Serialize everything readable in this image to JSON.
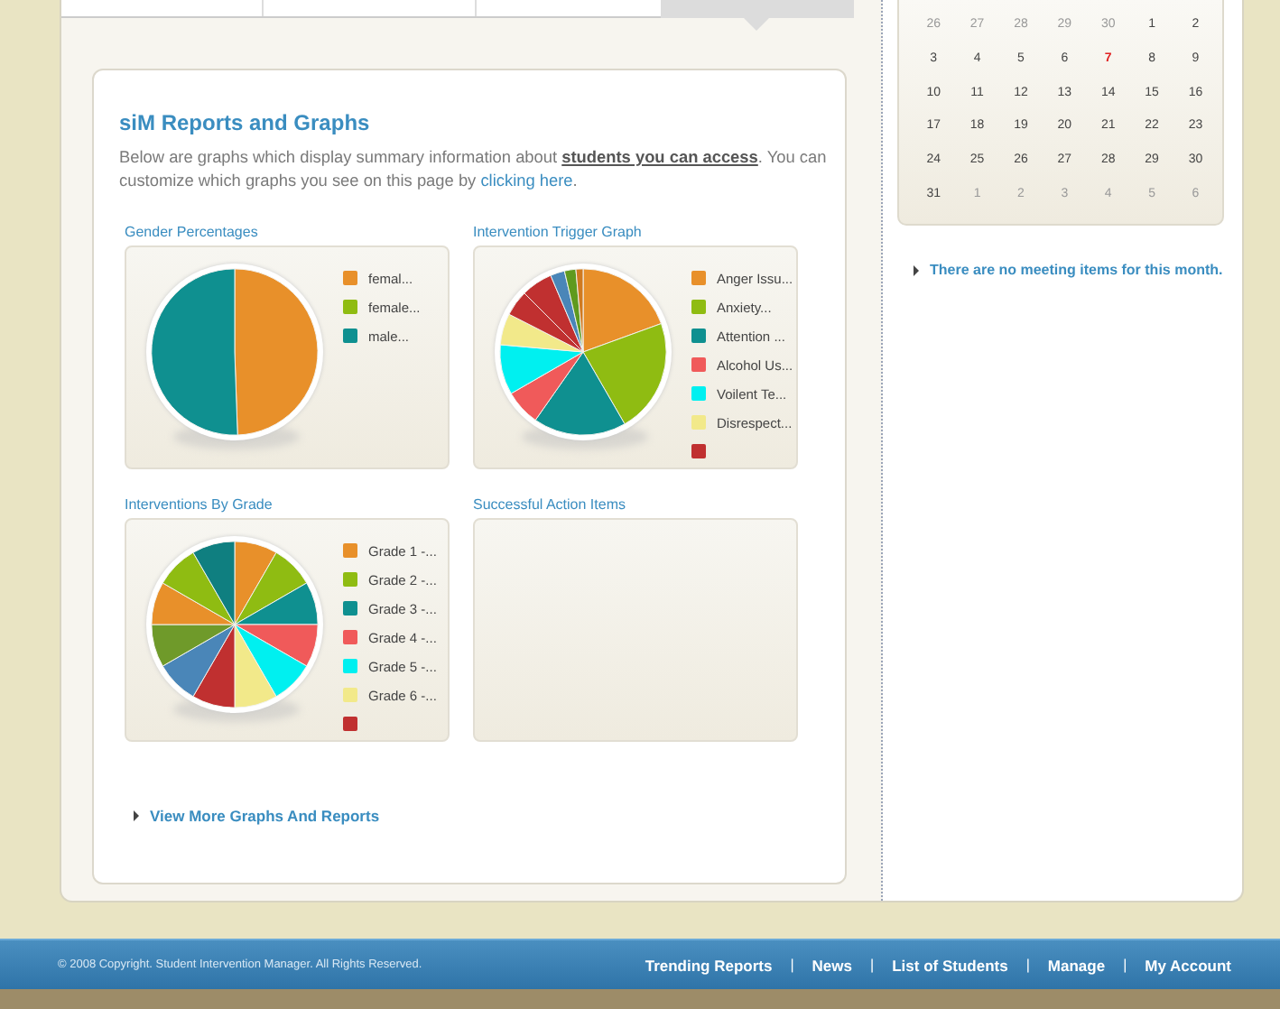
{
  "reports": {
    "title": "siM Reports and Graphs",
    "intro": {
      "before": "Below are graphs which display summary information about ",
      "access_link": "students you can access",
      "middle": ". You can customize which graphs you see on this page by ",
      "customize_link": "clicking here",
      "after": "."
    },
    "graphs": [
      {
        "title": "Gender Percentages",
        "kind": "pie",
        "legend": [
          {
            "label": "femal...",
            "color": "#e8902a"
          },
          {
            "label": "female...",
            "color": "#8fbc12"
          },
          {
            "label": "male...",
            "color": "#0f9090"
          }
        ]
      },
      {
        "title": "Intervention Trigger Graph",
        "kind": "pie",
        "legend": [
          {
            "label": "Anger Issu...",
            "color": "#e8902a"
          },
          {
            "label": "Anxiety...",
            "color": "#8fbc12"
          },
          {
            "label": "Attention ...",
            "color": "#0f9090"
          },
          {
            "label": "Alcohol Us...",
            "color": "#f05a5a"
          },
          {
            "label": "Voilent Te...",
            "color": "#00f0f0"
          },
          {
            "label": "Disrespect...",
            "color": "#f2e98a"
          },
          {
            "color": "#c03030"
          }
        ]
      },
      {
        "title": "Interventions By Grade",
        "kind": "pie",
        "legend": [
          {
            "label": "Grade 1 -...",
            "color": "#e8902a"
          },
          {
            "label": "Grade 2 -...",
            "color": "#8fbc12"
          },
          {
            "label": "Grade 3 -...",
            "color": "#0f9090"
          },
          {
            "label": "Grade 4 -...",
            "color": "#f05a5a"
          },
          {
            "label": "Grade 5 -...",
            "color": "#00f0f0"
          },
          {
            "label": "Grade 6 -...",
            "color": "#f2e98a"
          },
          {
            "color": "#c03030"
          }
        ]
      },
      {
        "title": "Successful Action Items",
        "kind": "empty"
      }
    ],
    "more_link": "View More Graphs And Reports"
  },
  "calendar": {
    "weeks": [
      [
        {
          "day": "26",
          "in_month": false,
          "selected": false
        },
        {
          "day": "27",
          "in_month": false,
          "selected": false
        },
        {
          "day": "28",
          "in_month": false,
          "selected": false
        },
        {
          "day": "29",
          "in_month": false,
          "selected": false
        },
        {
          "day": "30",
          "in_month": false,
          "selected": false
        },
        {
          "day": "1",
          "in_month": true,
          "selected": false
        },
        {
          "day": "2",
          "in_month": true,
          "selected": false
        }
      ],
      [
        {
          "day": "3",
          "in_month": true,
          "selected": false
        },
        {
          "day": "4",
          "in_month": true,
          "selected": false
        },
        {
          "day": "5",
          "in_month": true,
          "selected": false
        },
        {
          "day": "6",
          "in_month": true,
          "selected": false
        },
        {
          "day": "7",
          "in_month": true,
          "selected": true
        },
        {
          "day": "8",
          "in_month": true,
          "selected": false
        },
        {
          "day": "9",
          "in_month": true,
          "selected": false
        }
      ],
      [
        {
          "day": "10",
          "in_month": true,
          "selected": false
        },
        {
          "day": "11",
          "in_month": true,
          "selected": false
        },
        {
          "day": "12",
          "in_month": true,
          "selected": false
        },
        {
          "day": "13",
          "in_month": true,
          "selected": false
        },
        {
          "day": "14",
          "in_month": true,
          "selected": false
        },
        {
          "day": "15",
          "in_month": true,
          "selected": false
        },
        {
          "day": "16",
          "in_month": true,
          "selected": false
        }
      ],
      [
        {
          "day": "17",
          "in_month": true,
          "selected": false
        },
        {
          "day": "18",
          "in_month": true,
          "selected": false
        },
        {
          "day": "19",
          "in_month": true,
          "selected": false
        },
        {
          "day": "20",
          "in_month": true,
          "selected": false
        },
        {
          "day": "21",
          "in_month": true,
          "selected": false
        },
        {
          "day": "22",
          "in_month": true,
          "selected": false
        },
        {
          "day": "23",
          "in_month": true,
          "selected": false
        }
      ],
      [
        {
          "day": "24",
          "in_month": true,
          "selected": false
        },
        {
          "day": "25",
          "in_month": true,
          "selected": false
        },
        {
          "day": "26",
          "in_month": true,
          "selected": false
        },
        {
          "day": "27",
          "in_month": true,
          "selected": false
        },
        {
          "day": "28",
          "in_month": true,
          "selected": false
        },
        {
          "day": "29",
          "in_month": true,
          "selected": false
        },
        {
          "day": "30",
          "in_month": true,
          "selected": false
        }
      ],
      [
        {
          "day": "31",
          "in_month": true,
          "selected": false
        },
        {
          "day": "1",
          "in_month": false,
          "selected": false
        },
        {
          "day": "2",
          "in_month": false,
          "selected": false
        },
        {
          "day": "3",
          "in_month": false,
          "selected": false
        },
        {
          "day": "4",
          "in_month": false,
          "selected": false
        },
        {
          "day": "5",
          "in_month": false,
          "selected": false
        },
        {
          "day": "6",
          "in_month": false,
          "selected": false
        }
      ]
    ],
    "meetings_note": "There are no meeting items for this month."
  },
  "footer": {
    "copyright": "© 2008 Copyright. Student Intervention Manager. All Rights Reserved.",
    "separator": "|",
    "links": [
      "Trending Reports",
      "News",
      "List of Students",
      "Manage",
      "My Account"
    ]
  }
}
